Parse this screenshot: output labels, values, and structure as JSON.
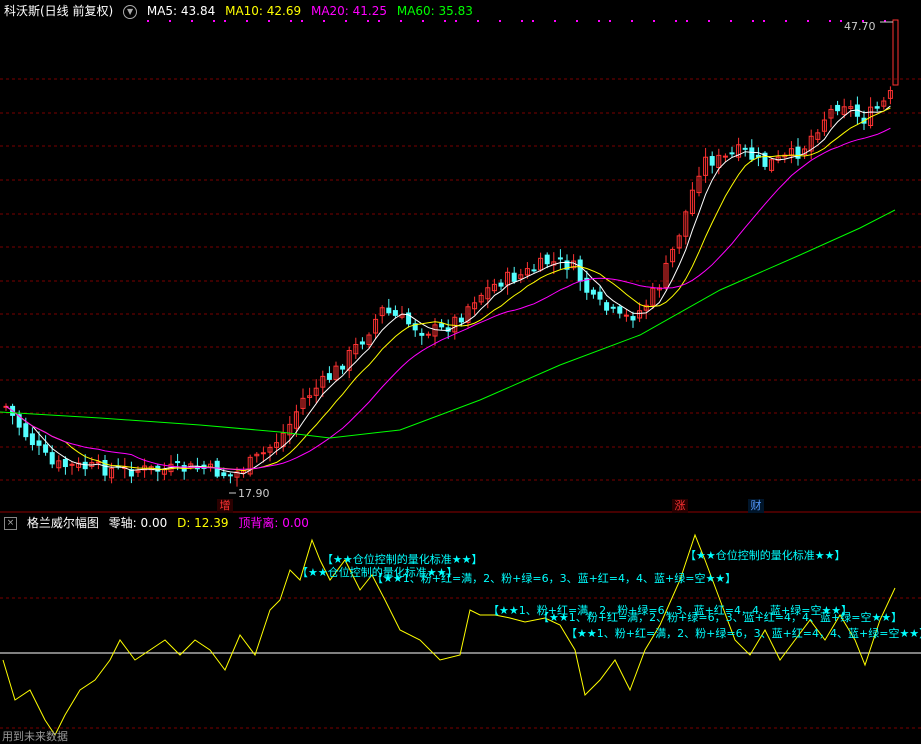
{
  "header": {
    "title": "科沃斯(日线 前复权)",
    "menu_icon": "circle-dropdown-icon",
    "ma": [
      {
        "label": "MA5: 43.84",
        "color": "#ffffff"
      },
      {
        "label": "MA10: 42.69",
        "color": "#ffff00"
      },
      {
        "label": "MA20: 41.25",
        "color": "#ff00ff"
      },
      {
        "label": "MA60: 35.83",
        "color": "#00ff00"
      }
    ]
  },
  "price": {
    "high_label": "47.70",
    "low_label": "17.90",
    "colors": {
      "up": "#ff3232",
      "down": "#54ffff",
      "ma5": "#ffffff",
      "ma10": "#ffff00",
      "ma20": "#ff00ff",
      "ma60": "#00ff00",
      "grid": "#7a0000"
    }
  },
  "events": [
    {
      "label": "增",
      "color": "#ff3333"
    },
    {
      "label": "涨",
      "color": "#ff3333"
    },
    {
      "label": "财",
      "color": "#5599ff"
    }
  ],
  "indicator": {
    "name": "格兰威尔幅图",
    "zero_label": "零轴: 0.00",
    "d_label": "D: 12.39",
    "div_label": "顶背离: 0.00",
    "colors": {
      "line": "#ffff00",
      "zero": "#ffffff"
    },
    "annotations": [
      "【★★仓位控制的量化标准★★】",
      "【★★仓位控制的量化标准★★】",
      "【★★1、粉+红=满，2、粉+绿=6，3、蓝+红=4，4、蓝+绿=空★★】",
      "【★★仓位控制的量化标准★★】",
      "【★★1、粉+红=满，2、粉+绿=6，3、蓝+红=4，4、蓝+绿=空★★】",
      "【★★1、粉+红=满，2、粉+绿=6，3、蓝+红=4，4、蓝+绿=空★★】",
      "【★★1、粉+红=满，2、粉+绿=6，3、蓝+红=4，4、蓝+绿=空★★】"
    ]
  },
  "footer": "用到未来数据"
}
